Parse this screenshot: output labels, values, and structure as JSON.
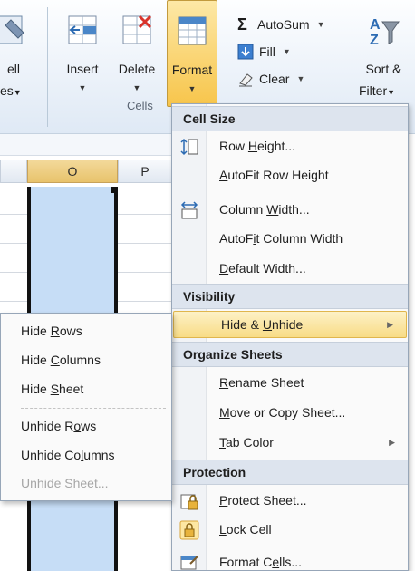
{
  "ribbon": {
    "partial_left_label_1": "ell",
    "partial_left_label_2": "es",
    "insert_label": "Insert",
    "delete_label": "Delete",
    "format_label": "Format",
    "cells_group_label": "Cells",
    "autosum_label": "AutoSum",
    "fill_label": "Fill",
    "clear_label": "Clear",
    "sort_label_1": "Sort &",
    "sort_label_2": "Filter",
    "dropdown_glyph": "▼",
    "sigma_glyph": "Σ"
  },
  "grid": {
    "columns": [
      "O",
      "P"
    ],
    "selected_column": "O"
  },
  "format_menu": {
    "sections": {
      "cell_size": "Cell Size",
      "visibility": "Visibility",
      "organize": "Organize Sheets",
      "protection": "Protection"
    },
    "items": {
      "row_height": {
        "pre": "Row ",
        "key": "H",
        "post": "eight..."
      },
      "autofit_row": {
        "pre": "",
        "key": "A",
        "post": "utoFit Row Height"
      },
      "column_width": {
        "pre": "Column ",
        "key": "W",
        "post": "idth..."
      },
      "autofit_column": {
        "pre": "AutoF",
        "key": "i",
        "post": "t Column Width"
      },
      "default_width": {
        "pre": "",
        "key": "D",
        "post": "efault Width..."
      },
      "hide_unhide": {
        "pre": "Hide & ",
        "key": "U",
        "post": "nhide"
      },
      "rename_sheet": {
        "pre": "",
        "key": "R",
        "post": "ename Sheet"
      },
      "move_copy": {
        "pre": "",
        "key": "M",
        "post": "ove or Copy Sheet..."
      },
      "tab_color": {
        "pre": "",
        "key": "T",
        "post": "ab Color"
      },
      "protect_sheet": {
        "pre": "",
        "key": "P",
        "post": "rotect Sheet..."
      },
      "lock_cell": {
        "pre": "",
        "key": "L",
        "post": "ock Cell"
      },
      "format_cells": {
        "pre": "Format C",
        "key": "e",
        "post": "lls..."
      }
    }
  },
  "hide_unhide_menu": {
    "hide_rows": {
      "pre": "Hide ",
      "key": "R",
      "post": "ows"
    },
    "hide_columns": {
      "pre": "Hide ",
      "key": "C",
      "post": "olumns"
    },
    "hide_sheet": {
      "pre": "Hide ",
      "key": "S",
      "post": "heet"
    },
    "unhide_rows": {
      "pre": "Unhide R",
      "key": "o",
      "post": "ws"
    },
    "unhide_columns": {
      "pre": "Unhide Co",
      "key": "l",
      "post": "umns"
    },
    "unhide_sheet": {
      "pre": "Un",
      "key": "h",
      "post": "ide Sheet..."
    },
    "unhide_sheet_disabled": true
  },
  "colors": {
    "menu_highlight": "#f8dc86",
    "selection_fill": "#c6ddf6",
    "section_header": "#dde4ee"
  }
}
